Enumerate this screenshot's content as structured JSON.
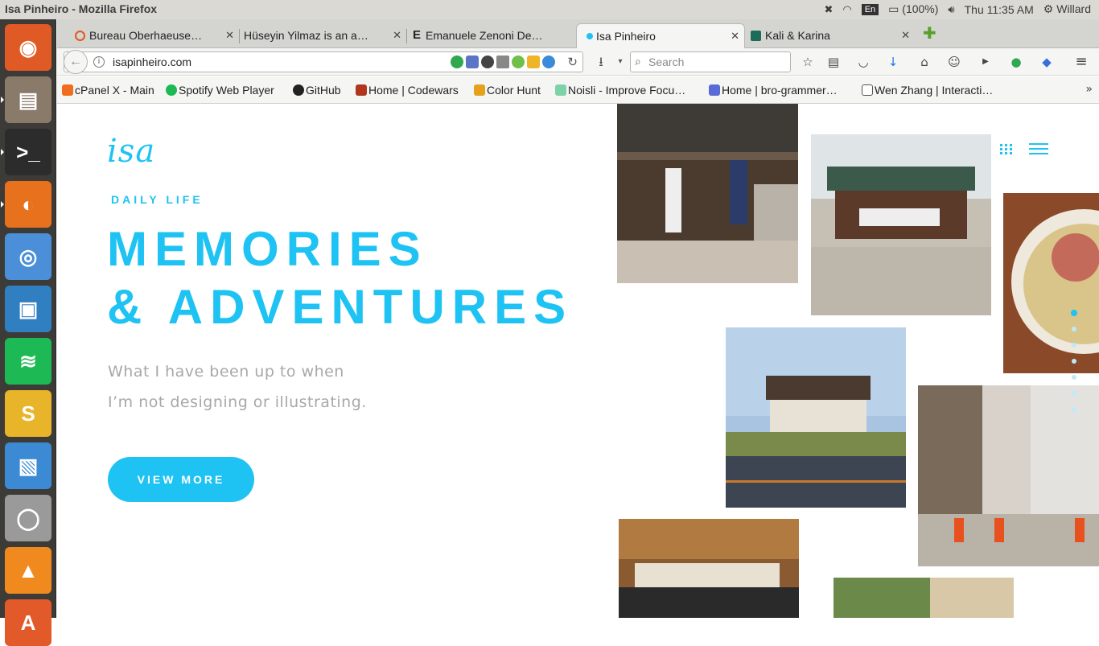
{
  "window": {
    "title": "Isa Pinheiro - Mozilla Firefox"
  },
  "system_tray": {
    "keyboard_layout": "En",
    "battery": "(100%)",
    "clock": "Thu 11:35 AM",
    "user": "Willard"
  },
  "launcher": [
    {
      "name": "dash-home",
      "color": "#e05a25",
      "glyph": "◉"
    },
    {
      "name": "files",
      "color": "#8a7a6a",
      "glyph": "▤"
    },
    {
      "name": "terminal",
      "color": "#2c2c2c",
      "glyph": ">_"
    },
    {
      "name": "firefox",
      "color": "#e8711d",
      "glyph": "◐"
    },
    {
      "name": "chrome",
      "color": "#4a8fd7",
      "glyph": "◎"
    },
    {
      "name": "app-frame",
      "color": "#2f7fc1",
      "glyph": "▣"
    },
    {
      "name": "spotify",
      "color": "#1db954",
      "glyph": "≋"
    },
    {
      "name": "slack",
      "color": "#e8b42a",
      "glyph": "S"
    },
    {
      "name": "libreoffice-draw",
      "color": "#3c8ad3",
      "glyph": "▧"
    },
    {
      "name": "disk",
      "color": "#9a9a9a",
      "glyph": "◯"
    },
    {
      "name": "vlc",
      "color": "#f08a1e",
      "glyph": "▲"
    },
    {
      "name": "software-center",
      "color": "#e2592a",
      "glyph": "A"
    }
  ],
  "tabs": [
    {
      "label": "Bureau Oberhaeuse…",
      "icon_color": "#e25822",
      "active": false
    },
    {
      "label": "Hüseyin Yilmaz is an ant…",
      "icon_color": "#d8d8d8",
      "active": false
    },
    {
      "label": "Emanuele Zenoni De…",
      "icon_color": "#222222",
      "active": false
    },
    {
      "label": "Isa Pinheiro",
      "icon_color": "#1ec3f3",
      "active": true
    },
    {
      "label": "Kali & Karina",
      "icon_color": "#1d6b5a",
      "active": false
    }
  ],
  "tab_close_glyph": "✕",
  "new_tab_glyph": "✚",
  "url": "isapinheiro.com",
  "search_placeholder": "Search",
  "bookmarks": [
    {
      "label": "cPanel X - Main",
      "icon_color": "#f06c1e"
    },
    {
      "label": "Spotify Web Player",
      "icon_color": "#1db954"
    },
    {
      "label": "GitHub",
      "icon_color": "#222222"
    },
    {
      "label": "Home | Codewars",
      "icon_color": "#b1361e"
    },
    {
      "label": "Color Hunt",
      "icon_color": "#e3a21a"
    },
    {
      "label": "Noisli - Improve Focu…",
      "icon_color": "#7dd3a7"
    },
    {
      "label": "Home | bro-grammer…",
      "icon_color": "#5b6bd6"
    },
    {
      "label": "Wen Zhang | Interacti…",
      "icon_color": "#555555"
    }
  ],
  "bookmarks_more_glyph": "»",
  "page": {
    "logo": "isa",
    "eyebrow": "DAILY LIFE",
    "headline_line1": "MEMORIES",
    "headline_line2": "& ADVENTURES",
    "subtitle_line1": "What I have been up to when",
    "subtitle_line2": "I’m not designing or illustrating.",
    "cta": "VIEW MORE",
    "accent_color": "#1ec3f3"
  }
}
